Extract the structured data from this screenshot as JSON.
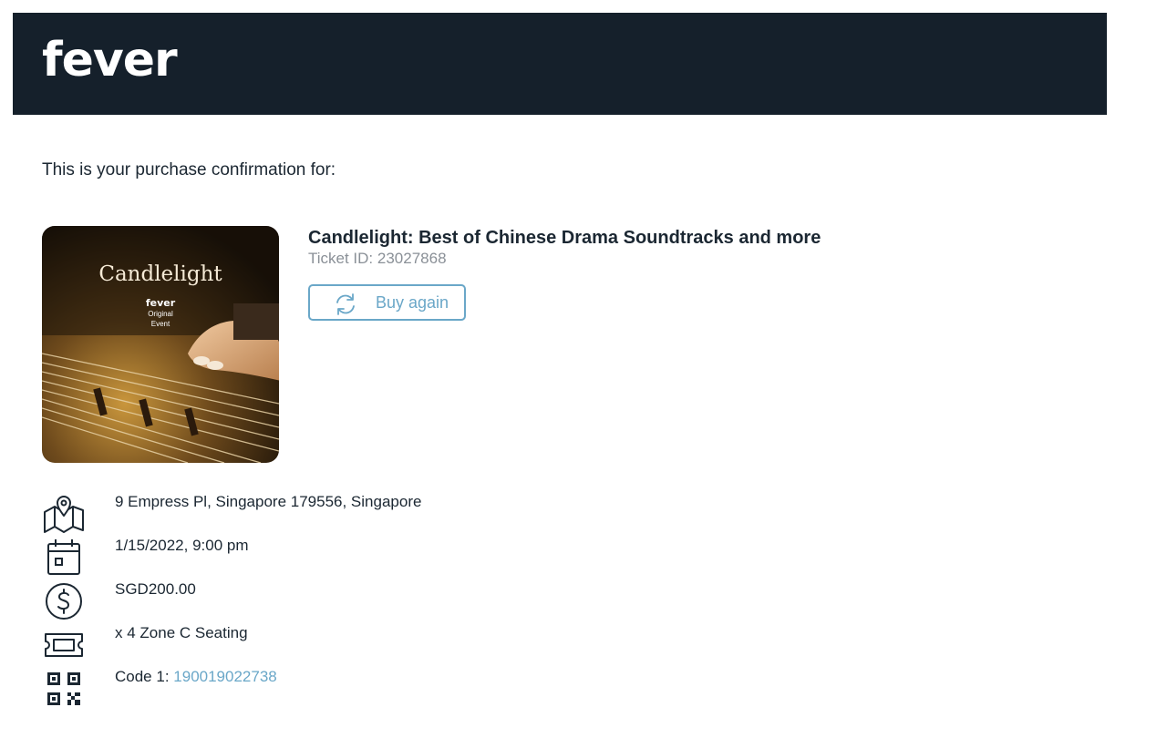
{
  "header": {
    "logo_text": "fever"
  },
  "intro_text": "This is your purchase confirmation for:",
  "event": {
    "image": {
      "brand_title": "Candlelight",
      "badge_brand": "fever",
      "badge_line1": "Original",
      "badge_line2": "Event"
    },
    "title": "Candlelight: Best of Chinese Drama Soundtracks and more",
    "ticket_id_label": "Ticket ID:",
    "ticket_id": "23027868",
    "buy_again_label": "Buy again"
  },
  "details": {
    "address": {
      "icon": "map-icon",
      "text": "9 Empress Pl, Singapore 179556, Singapore"
    },
    "datetime": {
      "icon": "calendar-icon",
      "text": "1/15/2022, 9:00 pm"
    },
    "price": {
      "icon": "dollar-icon",
      "text": "SGD200.00"
    },
    "tickets": {
      "icon": "ticket-icon",
      "text": "x 4 Zone C Seating"
    },
    "code": {
      "icon": "qr-code-icon",
      "label": "Code 1:",
      "value": "190019022738"
    }
  },
  "colors": {
    "header_bg": "#15202b",
    "text": "#1b2732",
    "muted": "#8a9097",
    "accent": "#6aa7c8"
  }
}
